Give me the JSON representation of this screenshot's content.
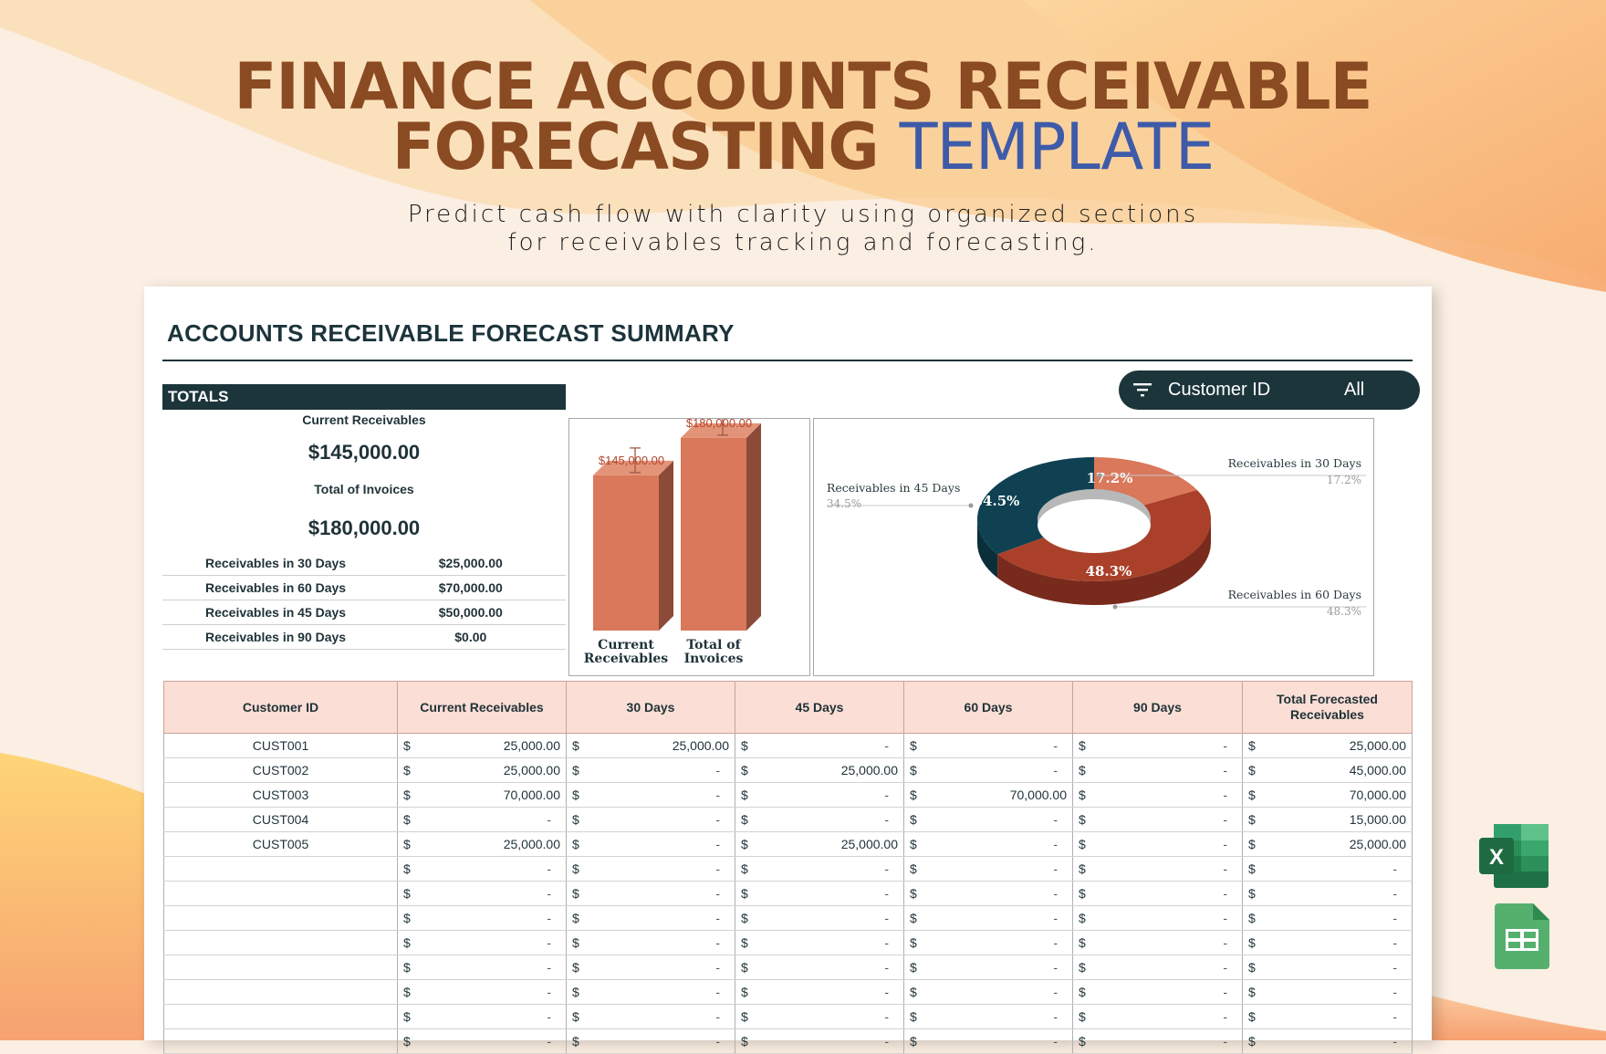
{
  "hero": {
    "title_line1": "FINANCE ACCOUNTS RECEIVABLE",
    "title_line2": "FORECASTING",
    "title_accent": "TEMPLATE",
    "subtitle_line1": "Predict cash flow with clarity using organized sections",
    "subtitle_line2": "for receivables tracking and forecasting."
  },
  "sheet": {
    "title": "ACCOUNTS RECEIVABLE FORECAST SUMMARY",
    "totals": {
      "header": "TOTALS",
      "current_label": "Current Receivables",
      "current_value": "$145,000.00",
      "invoices_label": "Total of Invoices",
      "invoices_value": "$180,000.00",
      "rows": [
        {
          "label": "Receivables in 30 Days",
          "value": "$25,000.00"
        },
        {
          "label": "Receivables in 60 Days",
          "value": "$70,000.00"
        },
        {
          "label": "Receivables in 45 Days",
          "value": "$50,000.00"
        },
        {
          "label": "Receivables in 90 Days",
          "value": "$0.00"
        }
      ]
    },
    "filter": {
      "icon": "filter-icon",
      "label": "Customer ID",
      "value": "All"
    },
    "table": {
      "headers": [
        "Customer ID",
        "Current Receivables",
        "30 Days",
        "45 Days",
        "60 Days",
        "90 Days",
        "Total Forecasted Receivables"
      ],
      "currency_symbol": "$",
      "empty_value": "-",
      "rows": [
        {
          "id": "CUST001",
          "values": [
            "25,000.00",
            "25,000.00",
            "-",
            "-",
            "-",
            "25,000.00"
          ]
        },
        {
          "id": "CUST002",
          "values": [
            "25,000.00",
            "-",
            "25,000.00",
            "-",
            "-",
            "45,000.00"
          ]
        },
        {
          "id": "CUST003",
          "values": [
            "70,000.00",
            "-",
            "-",
            "70,000.00",
            "-",
            "70,000.00"
          ]
        },
        {
          "id": "CUST004",
          "values": [
            "-",
            "-",
            "-",
            "-",
            "-",
            "15,000.00"
          ]
        },
        {
          "id": "CUST005",
          "values": [
            "25,000.00",
            "-",
            "25,000.00",
            "-",
            "-",
            "25,000.00"
          ]
        },
        {
          "id": "",
          "values": [
            "-",
            "-",
            "-",
            "-",
            "-",
            "-"
          ]
        },
        {
          "id": "",
          "values": [
            "-",
            "-",
            "-",
            "-",
            "-",
            "-"
          ]
        },
        {
          "id": "",
          "values": [
            "-",
            "-",
            "-",
            "-",
            "-",
            "-"
          ]
        },
        {
          "id": "",
          "values": [
            "-",
            "-",
            "-",
            "-",
            "-",
            "-"
          ]
        },
        {
          "id": "",
          "values": [
            "-",
            "-",
            "-",
            "-",
            "-",
            "-"
          ]
        },
        {
          "id": "",
          "values": [
            "-",
            "-",
            "-",
            "-",
            "-",
            "-"
          ]
        },
        {
          "id": "",
          "values": [
            "-",
            "-",
            "-",
            "-",
            "-",
            "-"
          ]
        },
        {
          "id": "",
          "values": [
            "-",
            "-",
            "-",
            "-",
            "-",
            "-"
          ]
        }
      ]
    }
  },
  "side_icons": [
    {
      "name": "excel-icon",
      "label": "X"
    },
    {
      "name": "google-sheets-icon"
    }
  ],
  "colors": {
    "title_brown": "#8a4a22",
    "title_accent": "#3e5ba9",
    "dark_teal": "#1c353b",
    "bar_face": "#d9785a",
    "header_pink": "#fbded5",
    "pie_30": "#d9785a",
    "pie_45": "#0f4152",
    "pie_60": "#aa4029"
  },
  "chart_data": [
    {
      "type": "bar",
      "style": "3d-column",
      "categories": [
        "Current Receivables",
        "Total of Invoices"
      ],
      "values": [
        145000,
        180000
      ],
      "data_labels": [
        "$145,000.00",
        "$180,000.00"
      ],
      "error_bars": true,
      "title": "",
      "xlabel": "",
      "ylabel": "",
      "ylim": [
        0,
        200000
      ],
      "grid": false
    },
    {
      "type": "pie",
      "style": "3d-donut",
      "categories": [
        "Receivables in 30 Days",
        "Receivables in 60 Days",
        "Receivables in 45 Days"
      ],
      "values": [
        17.2,
        48.3,
        34.5
      ],
      "data_labels": [
        "17.2%",
        "48.3%",
        "34.5%"
      ],
      "title": "",
      "legend": "callouts"
    }
  ]
}
